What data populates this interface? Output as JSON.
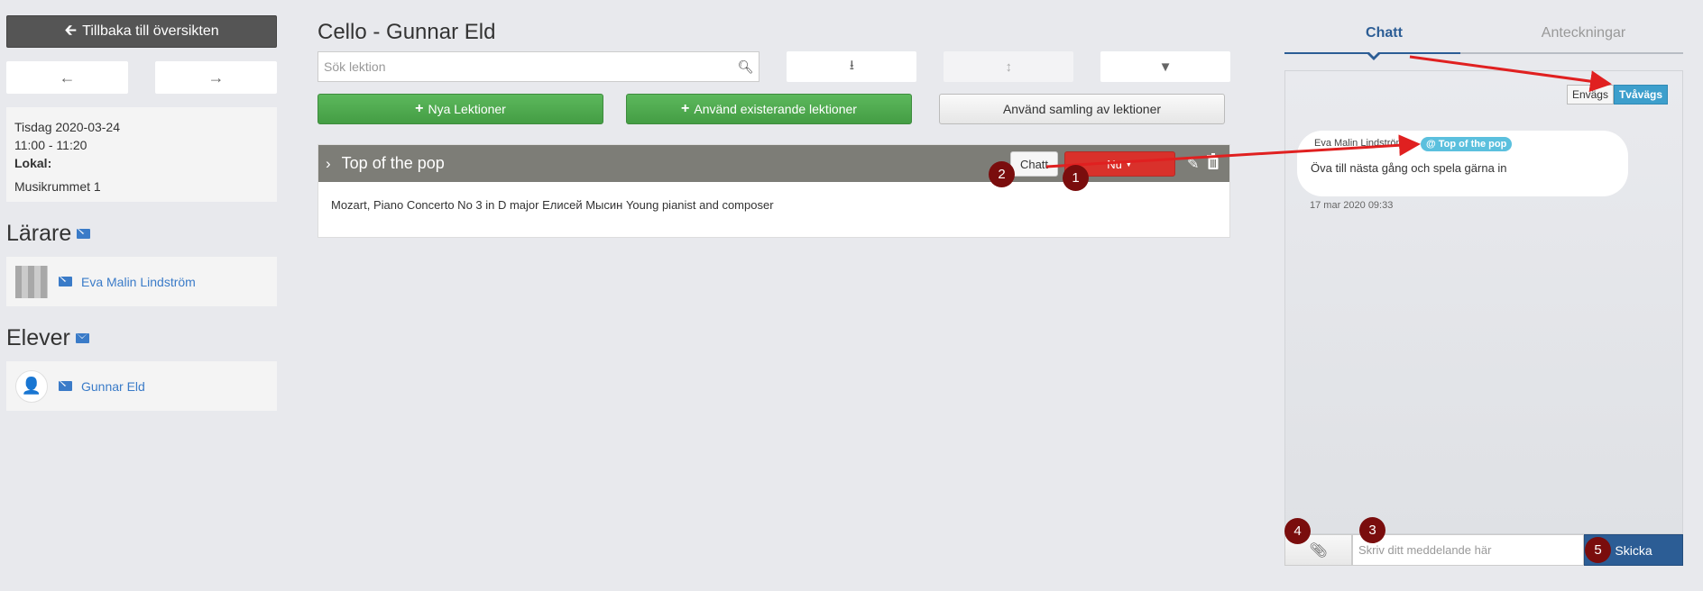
{
  "left": {
    "back_label": "Tillbaka till översikten",
    "prev_icon": "arrow-left-icon",
    "next_icon": "arrow-right-icon",
    "info": {
      "date": "Tisdag 2020-03-24",
      "time": "11:00 - 11:20",
      "location_label": "Lokal:",
      "room": "Musikrummet 1"
    },
    "teachers_heading": "Lärare",
    "teacher_name": "Eva Malin Lindström",
    "students_heading": "Elever",
    "student_name": "Gunnar Eld"
  },
  "main": {
    "title": "Cello - Gunnar Eld",
    "search_placeholder": "Sök lektion",
    "new_lessons_label": "Nya Lektioner",
    "use_existing_label": "Använd existerande lektioner",
    "use_collection_label": "Använd samling av lektioner",
    "lesson": {
      "title": "Top of the pop",
      "chat_label": "Chatt",
      "status_label": "Nu",
      "description": "Mozart, Piano Concerto No 3 in D major Елисей Мысин Young pianist and composer"
    }
  },
  "chat": {
    "tabs": [
      "Chatt",
      "Anteckningar"
    ],
    "mode_oneway": "Envägs",
    "mode_twoway": "Tvåvägs",
    "message": {
      "author": "Eva Malin Lindström",
      "tag": "@ Top of the pop",
      "text": "Öva till nästa gång och spela gärna in",
      "time": "17 mar 2020 09:33"
    },
    "input_placeholder": "Skriv ditt meddelande här",
    "send_label": "Skicka"
  },
  "annotations": {
    "badge_1": "1",
    "badge_2": "2",
    "badge_3": "3",
    "badge_4": "4",
    "badge_5": "5",
    "badge_color": "#7a0d0d",
    "arrow_color": "#e02020"
  }
}
